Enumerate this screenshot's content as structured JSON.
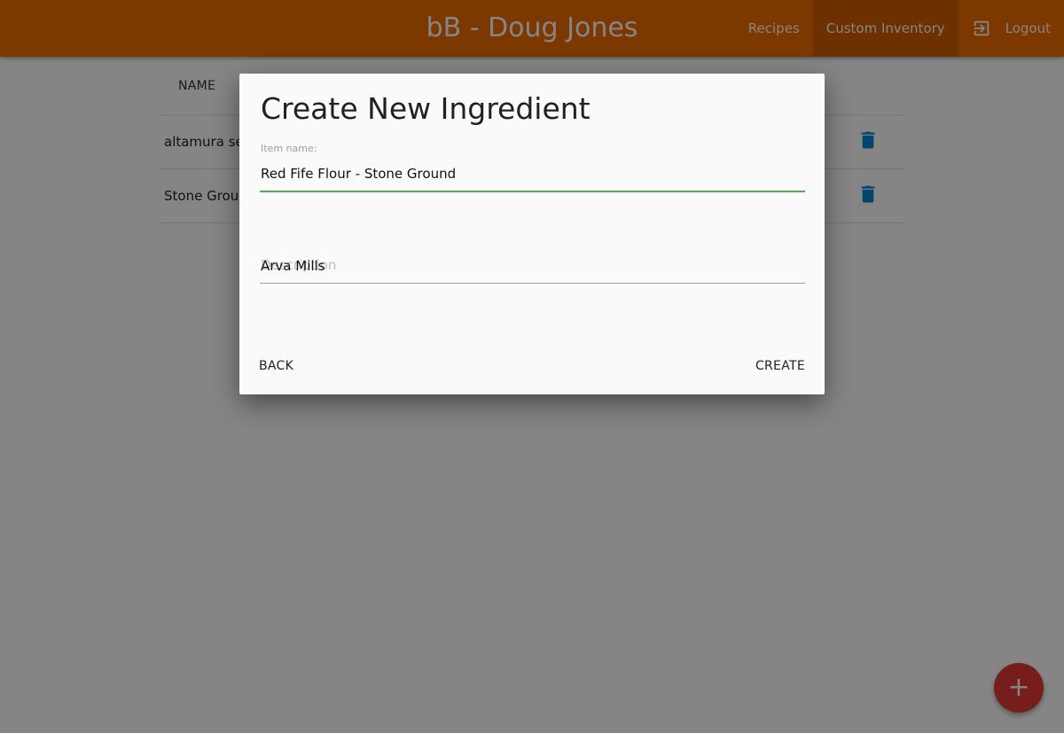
{
  "header": {
    "title": "bB - Doug Jones",
    "nav": {
      "recipes": "Recipes",
      "custom_inventory": "Custom Inventory",
      "logout": "Logout"
    },
    "active_tab": "Custom Inventory"
  },
  "table": {
    "columns": [
      "NAME"
    ],
    "rows": [
      {
        "name": "altamura ser"
      },
      {
        "name": "Stone Groun"
      }
    ]
  },
  "dialog": {
    "title": "Create New Ingredient",
    "item_name_label": "Item name:",
    "item_name_value": "Red Fife Flour - Stone Ground",
    "description_value": "Arva Mills",
    "description_placeholder": "Description",
    "back_label": "BACK",
    "create_label": "CREATE"
  },
  "fab": {
    "icon": "plus-icon",
    "symbol": "+"
  },
  "icons": {
    "logout": "logout-icon",
    "delete": "trash-icon"
  },
  "colors": {
    "appbar": "#ef6c00",
    "fab": "#e53935",
    "trash": "#0288d1",
    "active_input_underline": "#4caf50"
  }
}
